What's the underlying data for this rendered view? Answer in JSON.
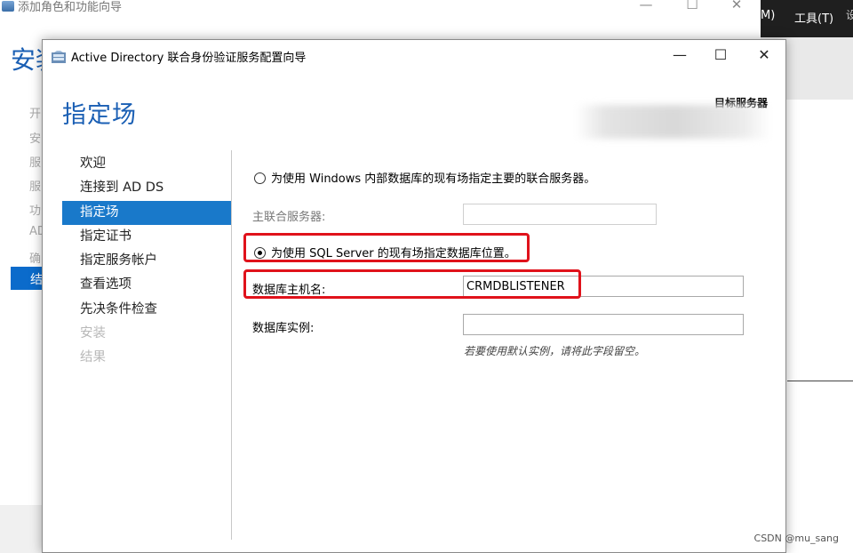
{
  "background_window": {
    "title": "添加角色和功能向导",
    "heading": "安装",
    "steps": [
      "开",
      "安",
      "服",
      "服",
      "功",
      "AD",
      "确"
    ],
    "active_step": "结",
    "controls": {
      "minimize": "—",
      "maximize": "☐",
      "close": "✕"
    }
  },
  "right_app": {
    "menu_m": "M)",
    "menu_tools": "工具(T)",
    "menu_more": "设"
  },
  "wizard": {
    "title": "Active Directory 联合身份验证服务配置向导",
    "controls": {
      "minimize": "—",
      "maximize": "☐",
      "close": "✕"
    },
    "page_heading": "指定场",
    "target_server_label": "目标服务器",
    "nav_items": [
      {
        "label": "欢迎",
        "state": "normal"
      },
      {
        "label": "连接到 AD DS",
        "state": "normal"
      },
      {
        "label": "指定场",
        "state": "selected"
      },
      {
        "label": "指定证书",
        "state": "normal"
      },
      {
        "label": "指定服务帐户",
        "state": "normal"
      },
      {
        "label": "查看选项",
        "state": "normal"
      },
      {
        "label": "先决条件检查",
        "state": "normal"
      },
      {
        "label": "安装",
        "state": "disabled"
      },
      {
        "label": "结果",
        "state": "disabled"
      }
    ],
    "option_wid": {
      "label": "为使用 Windows 内部数据库的现有场指定主要的联合服务器。",
      "checked": false
    },
    "primary_server": {
      "label": "主联合服务器:",
      "value": ""
    },
    "option_sql": {
      "label": "为使用 SQL Server 的现有场指定数据库位置。",
      "checked": true
    },
    "db_host": {
      "label": "数据库主机名:",
      "value": "CRMDBLISTENER"
    },
    "db_instance": {
      "label": "数据库实例:",
      "value": ""
    },
    "db_instance_hint": "若要使用默认实例，请将此字段留空。",
    "highlight_color": "#e0121b",
    "accent_color": "#1979ca"
  },
  "watermark": "CSDN @mu_sang"
}
